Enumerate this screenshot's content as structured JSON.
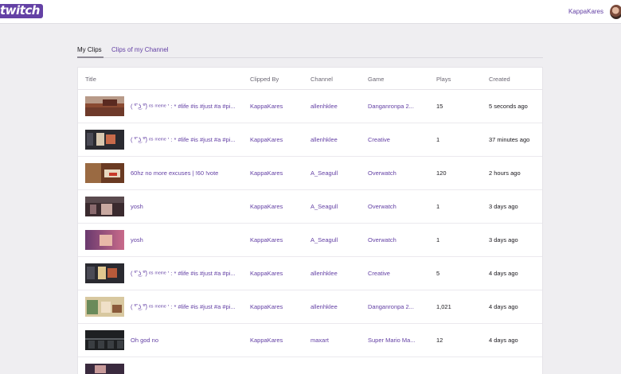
{
  "header": {
    "logo": "twitch",
    "username": "KappaKares"
  },
  "tabs": [
    {
      "label": "My Clips"
    },
    {
      "label": "Clips of my Channel"
    }
  ],
  "columns": [
    "Title",
    "Clipped By",
    "Channel",
    "Game",
    "Plays",
    "Created"
  ],
  "rows": [
    {
      "title": "( ͡° ͜ʖ ͡°) ᶦᵗˢ ᵐᵉᵐᵉ ' : * #life #is #just #a #pi...",
      "clipped_by": "KappaKares",
      "channel": "allenhklee",
      "game": "Danganronpa 2...",
      "plays": "15",
      "created": "5 seconds ago"
    },
    {
      "title": "( ͡° ͜ʖ ͡°) ᶦᵗˢ ᵐᵉᵐᵉ ' : * #life #is #just #a #pi...",
      "clipped_by": "KappaKares",
      "channel": "allenhklee",
      "game": "Creative",
      "plays": "1",
      "created": "37 minutes ago"
    },
    {
      "title": "60hz no more excuses | !60 !vote",
      "clipped_by": "KappaKares",
      "channel": "A_Seagull",
      "game": "Overwatch",
      "plays": "120",
      "created": "2 hours ago"
    },
    {
      "title": "yosh",
      "clipped_by": "KappaKares",
      "channel": "A_Seagull",
      "game": "Overwatch",
      "plays": "1",
      "created": "3 days ago"
    },
    {
      "title": "yosh",
      "clipped_by": "KappaKares",
      "channel": "A_Seagull",
      "game": "Overwatch",
      "plays": "1",
      "created": "3 days ago"
    },
    {
      "title": "( ͡° ͜ʖ ͡°) ᶦᵗˢ ᵐᵉᵐᵉ ' : * #life #is #just #a #pi...",
      "clipped_by": "KappaKares",
      "channel": "allenhklee",
      "game": "Creative",
      "plays": "5",
      "created": "4 days ago"
    },
    {
      "title": "( ͡° ͜ʖ ͡°) ᶦᵗˢ ᵐᵉᵐᵉ ' : * #life #is #just #a #pi...",
      "clipped_by": "KappaKares",
      "channel": "allenhklee",
      "game": "Danganronpa 2...",
      "plays": "1,021",
      "created": "4 days ago"
    },
    {
      "title": "Oh god no",
      "clipped_by": "KappaKares",
      "channel": "maxart",
      "game": "Super Mario Ma...",
      "plays": "12",
      "created": "4 days ago"
    }
  ]
}
